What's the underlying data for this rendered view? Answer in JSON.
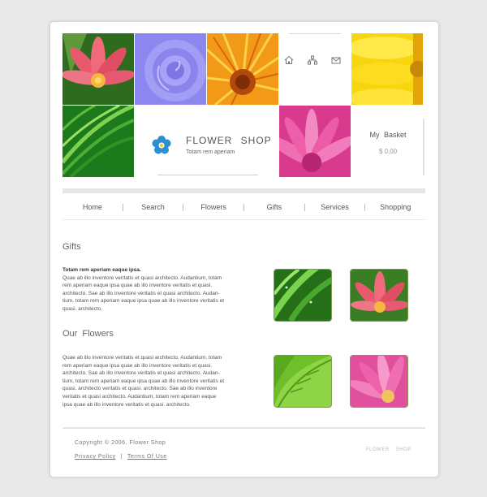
{
  "icons": {
    "home": "home-icon",
    "sitemap": "sitemap-icon",
    "mail": "mail-icon",
    "logo": "flower-logo-icon"
  },
  "brand": {
    "title": "FLOWER SHOP",
    "tagline": "Totam rem aperiam"
  },
  "basket": {
    "title": "My Basket",
    "value": "$ 0,00"
  },
  "nav": [
    "Home",
    "Search",
    "Flowers",
    "Gifts",
    "Services",
    "Shopping"
  ],
  "gifts": {
    "heading": "Gifts",
    "lead": "Totam rem aperiam eaque ipsa.",
    "lines": [
      "Quae ab illo inventore veritatis et quasi architecto. Audantium, totam",
      "rem aperiam eaque ipsa quae ab illo inventore veritatis et quasi.",
      "architecto. Sae ab illo inventore veritatis et quasi architecto. Audan-",
      "tium, totam rem aperiam eaque ipsa quae ab illo inventore veritatis et",
      "quasi. architecto."
    ]
  },
  "our_flowers": {
    "heading": "Our Flowers",
    "lines": [
      "Quae ab illo inventore veritatis et quasi architecto. Audantium, totam",
      "rem aperiam eaque ipsa quae ab illo inventore veritatis et quasi.",
      "architecto. Sae ab illo inventore veritatis et quasi architecto. Audan-",
      "tium, totam rem aperiam eaque ipsa quae ab illo inventore veritatis et",
      "quasi. architecto veritatis et quasi. architecto. Sae ab illo inventore",
      "veritatis et quasi architecto. Audantium, totam rem aperiam eaque",
      "ipsa quae ab illo inventore veritatis et quasi. architecto."
    ]
  },
  "footer": {
    "copyright": "Copyright © 2006. Flower Shop",
    "privacy": "Privacy Policy",
    "separator": "|",
    "terms": "Terms Of Use",
    "brand": "FLOWER SHOP"
  },
  "colors": {
    "accent_logo": "#2e8fd0",
    "thumb_border": "#7b9a52"
  }
}
